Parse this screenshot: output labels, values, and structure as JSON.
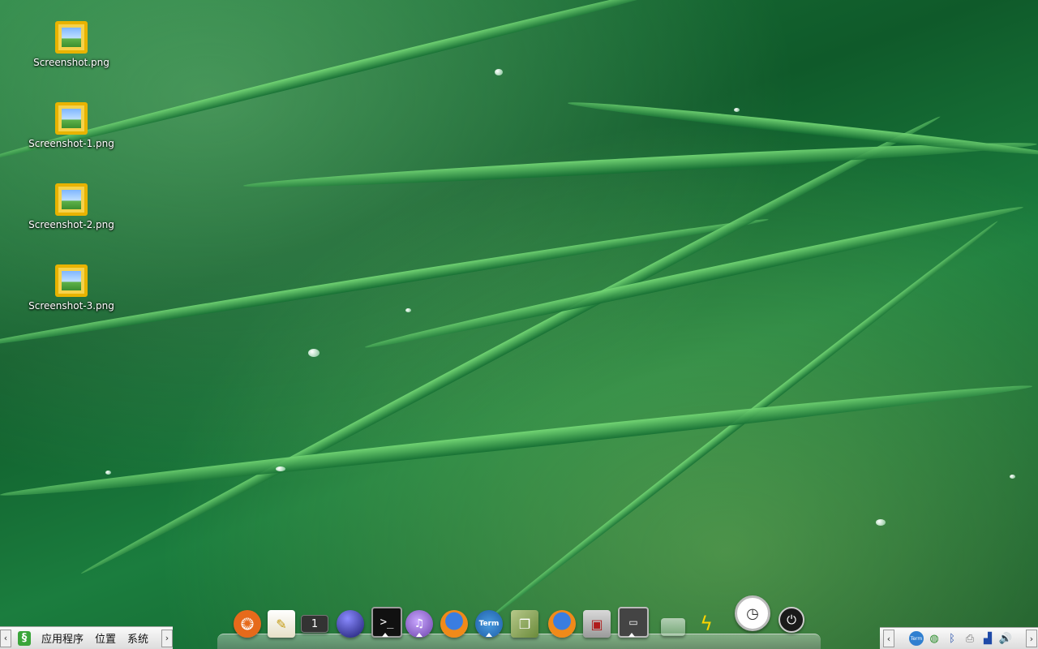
{
  "desktop": {
    "icons": [
      {
        "label": "Screenshot.png"
      },
      {
        "label": "Screenshot-1.png"
      },
      {
        "label": "Screenshot-2.png"
      },
      {
        "label": "Screenshot-3.png"
      }
    ]
  },
  "panel": {
    "menus": [
      "应用程序",
      "位置",
      "系统"
    ],
    "left_arrow": "‹",
    "right_arrow": "›"
  },
  "dock": {
    "workspace_number": "1",
    "term_label": "Term",
    "items": [
      "ubuntu-logo-icon",
      "text-editor-icon",
      "workspace-switcher-icon",
      "eclipse-icon",
      "terminal-icon",
      "pidgin-icon",
      "firefox-icon",
      "term-app-icon",
      "book-icon",
      "firefox-2-icon",
      "package-manager-icon",
      "monitor-icon",
      "trash-icon",
      "battery-icon",
      "clock-icon",
      "power-icon"
    ]
  },
  "tray": {
    "left_arrow": "‹",
    "right_arrow": "›",
    "term_label": "Term",
    "icons": [
      "term-tray-icon",
      "network-icon",
      "bluetooth-icon",
      "printer-icon",
      "signal-icon",
      "volume-icon"
    ]
  },
  "colors": {
    "panel_bg": "#e6e6e6",
    "icon_frame": "#e8b300",
    "wallpaper": "#1b7d3e"
  }
}
